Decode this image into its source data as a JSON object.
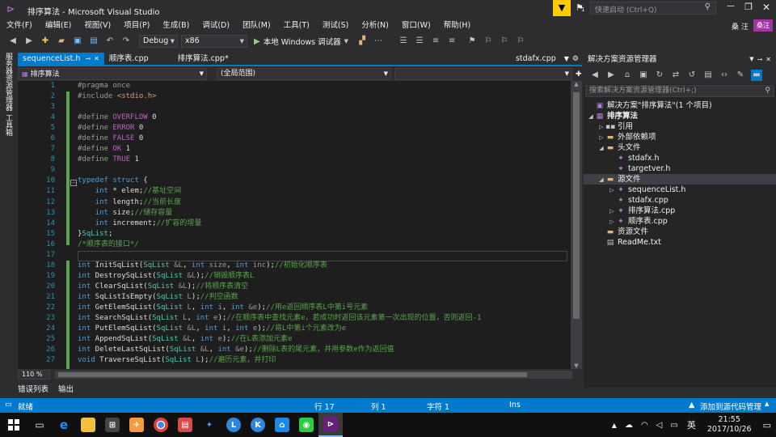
{
  "window": {
    "title": "排序算法 - Microsoft Visual Studio",
    "quick_launch": "快速启动 (Ctrl+Q)",
    "user": "桑 汪",
    "user_initials": "桑汪",
    "notifications": "1"
  },
  "menu": [
    "文件(F)",
    "编辑(E)",
    "视图(V)",
    "项目(P)",
    "生成(B)",
    "调试(D)",
    "团队(M)",
    "工具(T)",
    "测试(S)",
    "分析(N)",
    "窗口(W)",
    "帮助(H)"
  ],
  "toolbar": {
    "config": "Debug",
    "platform": "x86",
    "run_label": "本地 Windows 调试器"
  },
  "left_strip": [
    "服务器资源管理器",
    "工具箱"
  ],
  "doc_tabs": [
    {
      "label": "sequenceList.h",
      "active": true
    },
    {
      "label": "顺序表.cpp",
      "active": false
    },
    {
      "label": "排序算法.cpp*",
      "active": false
    },
    {
      "label": "stdafx.cpp",
      "active": false
    }
  ],
  "nav": {
    "project": "排序算法",
    "scope": "(全局范围)"
  },
  "code": {
    "lines": [
      "1",
      "2",
      "3",
      "4",
      "5",
      "6",
      "7",
      "8",
      "9",
      "10",
      "11",
      "12",
      "13",
      "14",
      "15",
      "16",
      "17",
      "18",
      "19",
      "20",
      "21",
      "22",
      "23",
      "24",
      "25",
      "26",
      "27"
    ],
    "zoom": "110 %"
  },
  "solution_explorer": {
    "title": "解决方案资源管理器",
    "search_placeholder": "搜索解决方案资源管理器(Ctrl+;)",
    "nodes": [
      {
        "label": "解决方案\"排序算法\"(1 个项目)",
        "level": 0,
        "icon": "solution-icon",
        "expand": ""
      },
      {
        "label": "排序算法",
        "level": 0,
        "icon": "project-icon",
        "expand": "open",
        "bold": true
      },
      {
        "label": "引用",
        "level": 1,
        "icon": "references-icon",
        "expand": "closed"
      },
      {
        "label": "外部依赖项",
        "level": 1,
        "icon": "folder-icon",
        "expand": "closed"
      },
      {
        "label": "头文件",
        "level": 1,
        "icon": "folder-icon",
        "expand": "open"
      },
      {
        "label": "stdafx.h",
        "level": 2,
        "icon": "header-file-icon",
        "expand": ""
      },
      {
        "label": "targetver.h",
        "level": 2,
        "icon": "header-file-icon",
        "expand": ""
      },
      {
        "label": "源文件",
        "level": 1,
        "icon": "folder-icon",
        "expand": "open",
        "selected": true
      },
      {
        "label": "sequenceList.h",
        "level": 2,
        "icon": "header-file-icon",
        "expand": "closed"
      },
      {
        "label": "stdafx.cpp",
        "level": 2,
        "icon": "cpp-file-icon",
        "expand": ""
      },
      {
        "label": "排序算法.cpp",
        "level": 2,
        "icon": "cpp-file-icon",
        "expand": "closed"
      },
      {
        "label": "顺序表.cpp",
        "level": 2,
        "icon": "cpp-file-icon",
        "expand": "closed"
      },
      {
        "label": "资源文件",
        "level": 1,
        "icon": "folder-icon",
        "expand": ""
      },
      {
        "label": "ReadMe.txt",
        "level": 1,
        "icon": "text-file-icon",
        "expand": ""
      }
    ]
  },
  "output_tabs": [
    "错误列表",
    "输出"
  ],
  "status": {
    "ready": "就绪",
    "line": "行 17",
    "col": "列 1",
    "char": "字符 1",
    "ins": "Ins",
    "source_control": "添加到源代码管理"
  },
  "taskbar": {
    "time": "21:55",
    "date": "2017/10/26",
    "ime": "英"
  },
  "colors": {
    "accent": "#007acc",
    "background": "#2d2d30",
    "editor": "#1e1e1e"
  }
}
